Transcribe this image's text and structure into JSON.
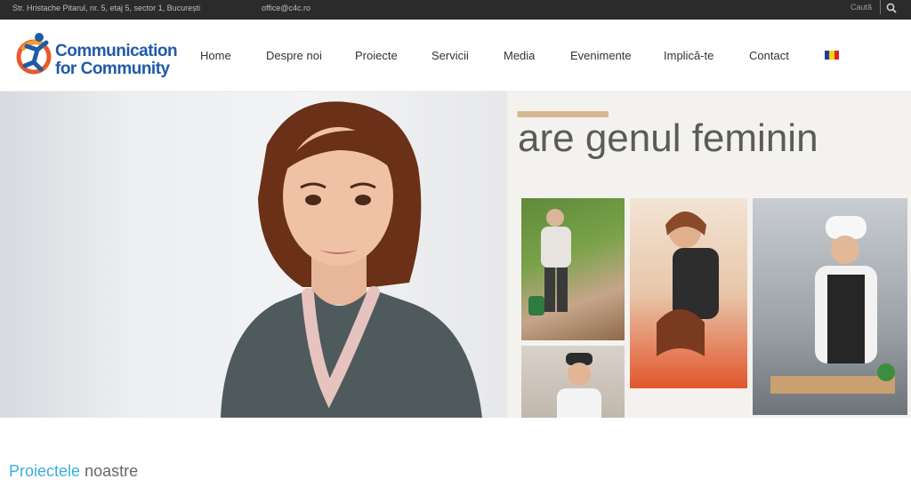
{
  "topbar": {
    "address": "Str. Hristache Pitarul, nr. 5, etaj 5, sector 1, București",
    "email": "office@c4c.ro",
    "search_label": "Caută"
  },
  "logo": {
    "line1": "Communication",
    "line2": "for Community"
  },
  "nav": {
    "items": [
      "Home",
      "Despre noi",
      "Proiecte",
      "Servicii",
      "Media",
      "Evenimente",
      "Implică-te",
      "Contact"
    ]
  },
  "language_flag": "Romanian flag",
  "hero": {
    "banner_text": "are genul feminin"
  },
  "section": {
    "title_highlight": "Proiectele",
    "title_rest": "noastre"
  },
  "colors": {
    "accent_blue": "#3aaee0",
    "logo_blue": "#1f5aa8",
    "topbar_bg": "#2b2b2b"
  }
}
